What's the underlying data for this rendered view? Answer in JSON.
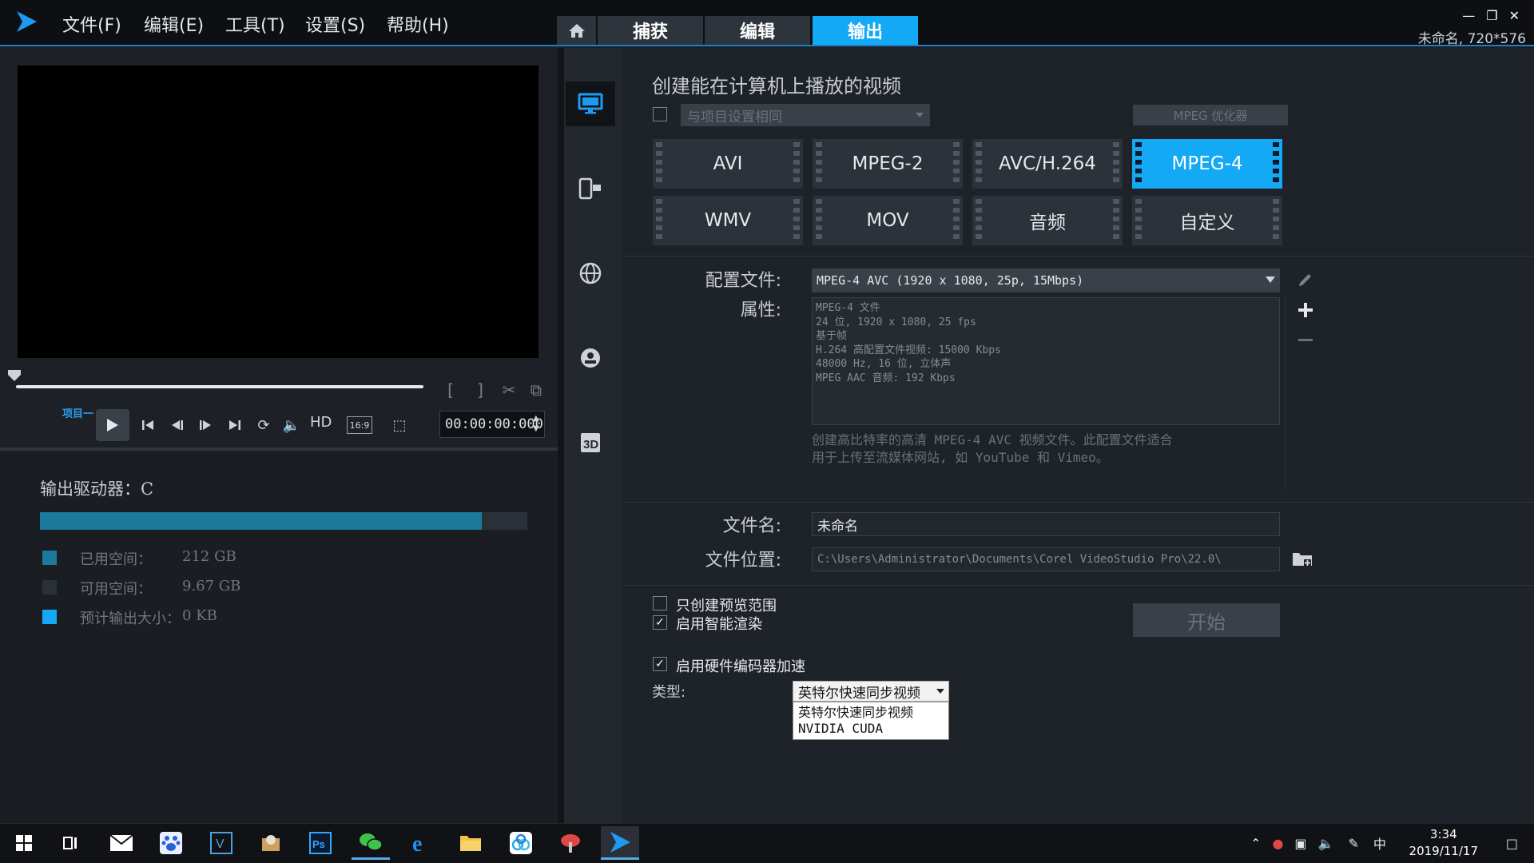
{
  "titlebar": {
    "menu": [
      "文件(F)",
      "编辑(E)",
      "工具(T)",
      "设置(S)",
      "帮助(H)"
    ],
    "tabs": [
      "捕获",
      "编辑",
      "输出"
    ],
    "active_tab": 2,
    "project_info": "未命名, 720*576",
    "window_controls": [
      "minimize-icon",
      "restore-icon",
      "close-icon"
    ]
  },
  "player": {
    "project_label": "项目一",
    "hd_label": "HD",
    "aspect_label": "16:9",
    "timecode": "00:00:00:000"
  },
  "drive": {
    "label": "输出驱动器：C",
    "used_fraction": 0.907,
    "legend": [
      {
        "label": "已用空间：",
        "value": "212 GB",
        "color": "#1b7a9c"
      },
      {
        "label": "可用空间：",
        "value": "9.67 GB",
        "color": "#2a3038"
      },
      {
        "label": "预计输出大小：",
        "value": "0 KB",
        "color": "#13a9f5"
      }
    ]
  },
  "output": {
    "title": "创建能在计算机上播放的视频",
    "same_settings": "与项目设置相同",
    "mpeg_optimizer": "MPEG 优化器",
    "formats": [
      "AVI",
      "MPEG-2",
      "AVC/H.264",
      "MPEG-4",
      "WMV",
      "MOV",
      "音频",
      "自定义"
    ],
    "active_format": 3,
    "profile_label": "配置文件:",
    "profile_value": "MPEG-4 AVC (1920 x 1080, 25p, 15Mbps)",
    "properties_label": "属性:",
    "properties": [
      "MPEG-4 文件",
      "24 位, 1920 x 1080, 25 fps",
      "基于帧",
      "H.264 高配置文件视频: 15000 Kbps",
      "48000 Hz, 16 位, 立体声",
      "MPEG AAC 音频: 192 Kbps"
    ],
    "description_line1": "创建高比特率的高清 MPEG-4 AVC 视频文件。此配置文件适合",
    "description_line2": "用于上传至流媒体网站, 如 YouTube 和 Vimeo。",
    "filename_label": "文件名:",
    "filename_value": "未命名",
    "location_label": "文件位置:",
    "location_value": "C:\\Users\\Administrator\\Documents\\Corel VideoStudio Pro\\22.0\\",
    "opt_preview_range": "只创建预览范围",
    "opt_smart_render": "启用智能渲染",
    "opt_hw_encoder": "启用硬件编码器加速",
    "start_label": "开始",
    "type_label": "类型:",
    "type_value": "英特尔快速同步视频",
    "type_options": [
      "英特尔快速同步视频",
      "NVIDIA CUDA"
    ]
  },
  "taskbar": {
    "clock_time": "3:34",
    "clock_date": "2019/11/17",
    "ime": "中"
  }
}
